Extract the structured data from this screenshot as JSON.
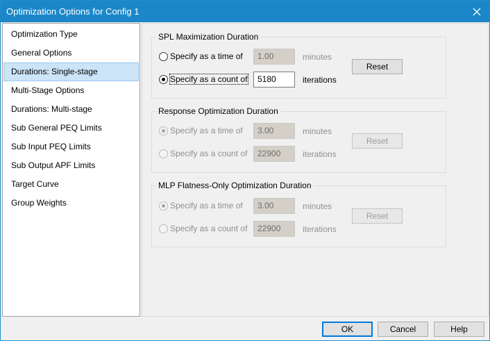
{
  "window": {
    "title": "Optimization Options for Config 1",
    "close_glyph": "×"
  },
  "sidebar": {
    "selected_index": 2,
    "items": [
      {
        "label": "Optimization Type"
      },
      {
        "label": "General Options"
      },
      {
        "label": "Durations: Single-stage"
      },
      {
        "label": "Multi-Stage Options"
      },
      {
        "label": "Durations: Multi-stage"
      },
      {
        "label": "Sub General PEQ Limits"
      },
      {
        "label": "Sub Input PEQ Limits"
      },
      {
        "label": "Sub Output APF Limits"
      },
      {
        "label": "Target Curve"
      },
      {
        "label": "Group Weights"
      }
    ]
  },
  "groups": [
    {
      "title": "SPL Maximization Duration",
      "enabled": true,
      "time_option": {
        "label": "Specify as a time of",
        "value": "1.00",
        "unit": "minutes",
        "checked": false
      },
      "count_option": {
        "label": "Specify as a count of",
        "value": "5180",
        "unit": "iterations",
        "checked": true
      },
      "reset_label": "Reset"
    },
    {
      "title": "Response Optimization Duration",
      "enabled": false,
      "time_option": {
        "label": "Specify as a time of",
        "value": "3.00",
        "unit": "minutes",
        "checked": true
      },
      "count_option": {
        "label": "Specify as a count of",
        "value": "22900",
        "unit": "iterations",
        "checked": false
      },
      "reset_label": "Reset"
    },
    {
      "title": "MLP Flatness-Only Optimization Duration",
      "enabled": false,
      "time_option": {
        "label": "Specify as a time of",
        "value": "3.00",
        "unit": "minutes",
        "checked": true
      },
      "count_option": {
        "label": "Specify as a count of",
        "value": "22900",
        "unit": "iterations",
        "checked": false
      },
      "reset_label": "Reset"
    }
  ],
  "footer": {
    "ok_label": "OK",
    "cancel_label": "Cancel",
    "help_label": "Help"
  },
  "colors": {
    "titlebar": "#1b87c9",
    "selection": "#cce4f7",
    "default_button_border": "#0078d7"
  }
}
